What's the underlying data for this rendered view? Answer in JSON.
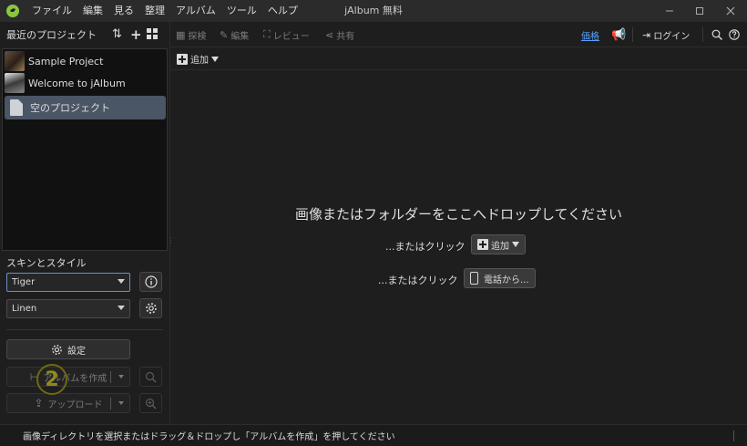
{
  "menu": {
    "items": [
      "ファイル",
      "編集",
      "見る",
      "整理",
      "アルバム",
      "ツール",
      "ヘルプ"
    ]
  },
  "window": {
    "title": "jAlbum 無料"
  },
  "projects": {
    "title": "最近のプロジェクト",
    "items": [
      {
        "label": "Sample Project"
      },
      {
        "label": "Welcome to jAlbum"
      },
      {
        "label": "空のプロジェクト",
        "selected": true
      }
    ]
  },
  "skins": {
    "title": "スキンとスタイル",
    "skin": "Tiger",
    "style": "Linen"
  },
  "actions": {
    "settings": "設定",
    "make_album": "アルバムを作成",
    "upload": "アップロード",
    "step_number": "2"
  },
  "toolbar": {
    "explore": "探検",
    "edit": "編集",
    "review": "レビュー",
    "share": "共有",
    "upgrade": "価格",
    "login": "ログイン"
  },
  "addbar": {
    "add_label": "追加"
  },
  "drop": {
    "title": "画像またはフォルダーをここへドロップしてください",
    "or_click_1": "...またはクリック",
    "add_label": "追加",
    "or_click_2": "...またはクリック",
    "phone_label": "電話から..."
  },
  "status": {
    "text": "画像ディレクトリを選択またはドラッグ＆ドロップし「アルバムを作成」を押してください"
  },
  "colors": {
    "accent_blue": "#5aa2ff",
    "selection": "#4a5566",
    "logo_green": "#8cc63f"
  }
}
